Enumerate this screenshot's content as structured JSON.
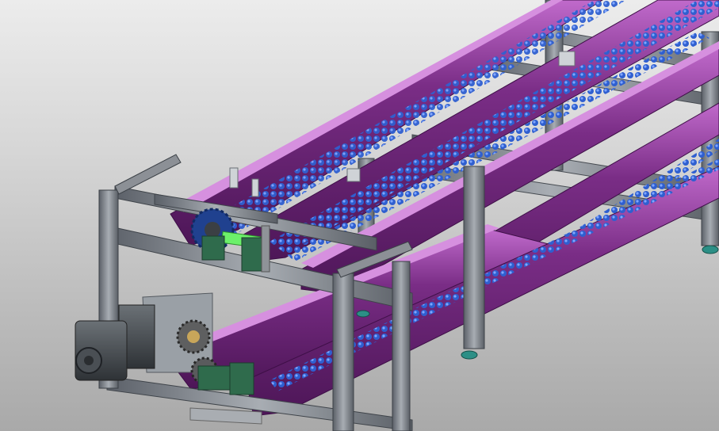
{
  "scene": {
    "subject": "conveyor-assembly-cad-render",
    "colors": {
      "background_top": "#ececec",
      "background_bottom": "#a9a9a9",
      "rail_purple": "#7a2d86",
      "rail_purple_dark": "#4d1657",
      "rail_purple_light": "#b057bd",
      "chain_blue": "#2f5fd0",
      "chain_blue_light": "#6f9cff",
      "frame_gray": "#8c9096",
      "frame_dark": "#4c5057",
      "motor_dark": "#3e4347",
      "bearing_green": "#2f6b4c",
      "shaft_green": "#6cf06a",
      "foot_teal": "#2c8f86"
    },
    "icons": [
      "motor",
      "gearbox",
      "sprocket",
      "bearing-block",
      "leveling-foot"
    ]
  }
}
